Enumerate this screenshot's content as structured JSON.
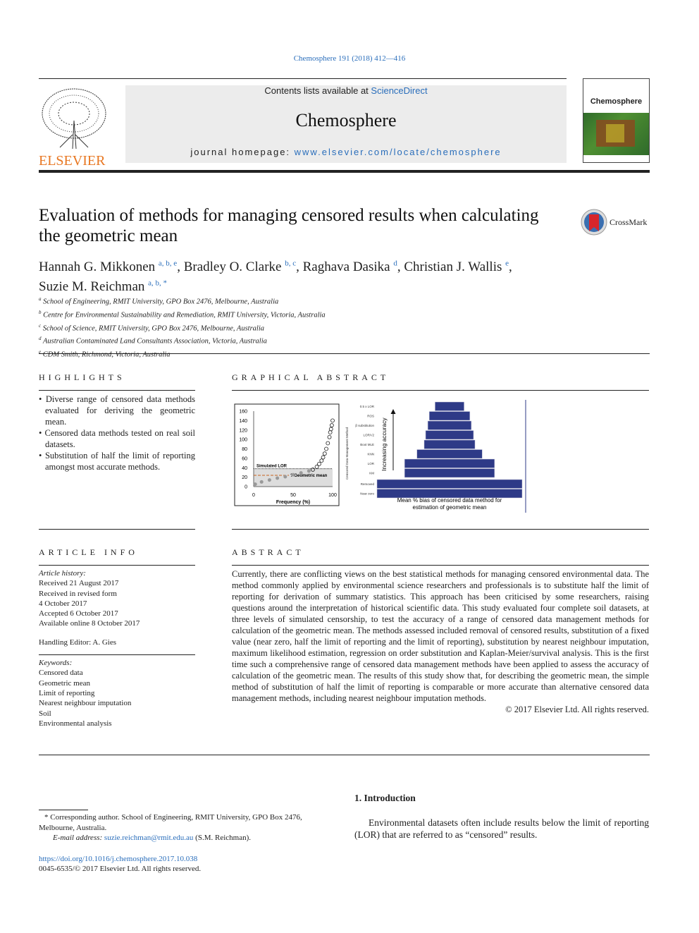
{
  "journal_ref": "Chemosphere 191 (2018) 412—416",
  "masthead": {
    "contents_prefix": "Contents lists available at ",
    "contents_link": "ScienceDirect",
    "journal": "Chemosphere",
    "homepage_prefix": "journal homepage: ",
    "homepage_link": "www.elsevier.com/locate/chemosphere"
  },
  "publisher": "ELSEVIER",
  "cover_title": "Chemosphere",
  "crossmark": "CrossMark",
  "title": "Evaluation of methods for managing censored results when calculating the geometric mean",
  "authors": [
    {
      "name": "Hannah G. Mikkonen",
      "aff": "a, b, e",
      "sep": ", "
    },
    {
      "name": "Bradley O. Clarke",
      "aff": "b, c",
      "sep": ", "
    },
    {
      "name": "Raghava Dasika",
      "aff": "d",
      "sep": ", "
    },
    {
      "name": "Christian J. Wallis",
      "aff": "e",
      "sep": ","
    },
    {
      "name": "Suzie M. Reichman",
      "aff": "a, b, *",
      "sep": ""
    }
  ],
  "affiliations": [
    {
      "key": "a",
      "text": "School of Engineering, RMIT University, GPO Box 2476, Melbourne, Australia"
    },
    {
      "key": "b",
      "text": "Centre for Environmental Sustainability and Remediation, RMIT University, Victoria, Australia"
    },
    {
      "key": "c",
      "text": "School of Science, RMIT University, GPO Box 2476, Melbourne, Australia"
    },
    {
      "key": "d",
      "text": "Australian Contaminated Land Consultants Association, Victoria, Australia"
    },
    {
      "key": "e",
      "text": "CDM Smith, Richmond, Victoria, Australia"
    }
  ],
  "highlights": {
    "heading": "HIGHLIGHTS",
    "items": [
      "Diverse range of censored data methods evaluated for deriving the geometric mean.",
      "Censored data methods tested on real soil datasets.",
      "Substitution of half the limit of reporting amongst most accurate methods."
    ]
  },
  "graphical_abstract": {
    "heading": "GRAPHICAL ABSTRACT"
  },
  "chart_data": [
    {
      "type": "scatter",
      "xlabel": "Frequency (%)",
      "ylabel": "",
      "xlim": [
        0,
        100
      ],
      "ylim": [
        0,
        160
      ],
      "xticks": [
        "0",
        "50",
        "100"
      ],
      "yticks": [
        "0",
        "20",
        "40",
        "60",
        "80",
        "100",
        "120",
        "140",
        "160"
      ],
      "annotations": [
        "Simulated LOR",
        "? Geometric mean"
      ],
      "lor": 38,
      "geometric_mean": 24,
      "x": [
        2,
        10,
        20,
        30,
        40,
        50,
        60,
        70,
        75,
        80,
        83,
        86,
        88,
        90,
        92,
        94,
        96,
        97,
        98,
        99,
        100
      ],
      "y": [
        5,
        10,
        14,
        18,
        21,
        25,
        29,
        33,
        36,
        42,
        48,
        55,
        62,
        70,
        80,
        92,
        105,
        115,
        122,
        130,
        140
      ]
    },
    {
      "type": "bar",
      "orientation": "horizontal",
      "xlabel": "Mean % bias of censored data method for estimation of geometric mean",
      "ylabel": "Censored Data Management Method",
      "annotation": "Increasing accuracy",
      "categories": [
        "0.5 x LOR",
        "ROS",
        "β substitution",
        "LOR/√2",
        "Boot MLE",
        "KNN",
        "LOR",
        "KM",
        "Removed",
        "Near zero"
      ],
      "values": [
        0.2,
        0.28,
        0.3,
        0.33,
        0.35,
        0.45,
        0.62,
        0.62,
        1,
        1
      ]
    }
  ],
  "article_info": {
    "heading": "ARTICLE INFO",
    "history_label": "Article history:",
    "history": [
      "Received 21 August 2017",
      "Received in revised form",
      "4 October 2017",
      "Accepted 6 October 2017",
      "Available online 8 October 2017"
    ],
    "editor": "Handling Editor: A. Gies",
    "keywords_label": "Keywords:",
    "keywords": [
      "Censored data",
      "Geometric mean",
      "Limit of reporting",
      "Nearest neighbour imputation",
      "Soil",
      "Environmental analysis"
    ]
  },
  "abstract": {
    "heading": "ABSTRACT",
    "text": "Currently, there are conflicting views on the best statistical methods for managing censored environmental data. The method commonly applied by environmental science researchers and professionals is to substitute half the limit of reporting for derivation of summary statistics. This approach has been criticised by some researchers, raising questions around the interpretation of historical scientific data. This study evaluated four complete soil datasets, at three levels of simulated censorship, to test the accuracy of a range of censored data management methods for calculation of the geometric mean. The methods assessed included removal of censored results, substitution of a fixed value (near zero, half the limit of reporting and the limit of reporting), substitution by nearest neighbour imputation, maximum likelihood estimation, regression on order substitution and Kaplan-Meier/survival analysis. This is the first time such a comprehensive range of censored data management methods have been applied to assess the accuracy of calculation of the geometric mean. The results of this study show that, for describing the geometric mean, the simple method of substitution of half the limit of reporting is comparable or more accurate than alternative censored data management methods, including nearest neighbour imputation methods.",
    "copyright": "© 2017 Elsevier Ltd. All rights reserved."
  },
  "footnote": {
    "corresponding": "* Corresponding author. School of Engineering, RMIT University, GPO Box 2476, Melbourne, Australia.",
    "email_label": "E-mail address: ",
    "email": "suzie.reichman@rmit.edu.au",
    "email_suffix": " (S.M. Reichman)."
  },
  "doi": "https://doi.org/10.1016/j.chemosphere.2017.10.038",
  "issn": "0045-6535/© 2017 Elsevier Ltd. All rights reserved.",
  "intro": {
    "heading": "1.  Introduction",
    "text": "Environmental datasets often include results below the limit of reporting (LOR) that are referred to as “censored” results."
  }
}
